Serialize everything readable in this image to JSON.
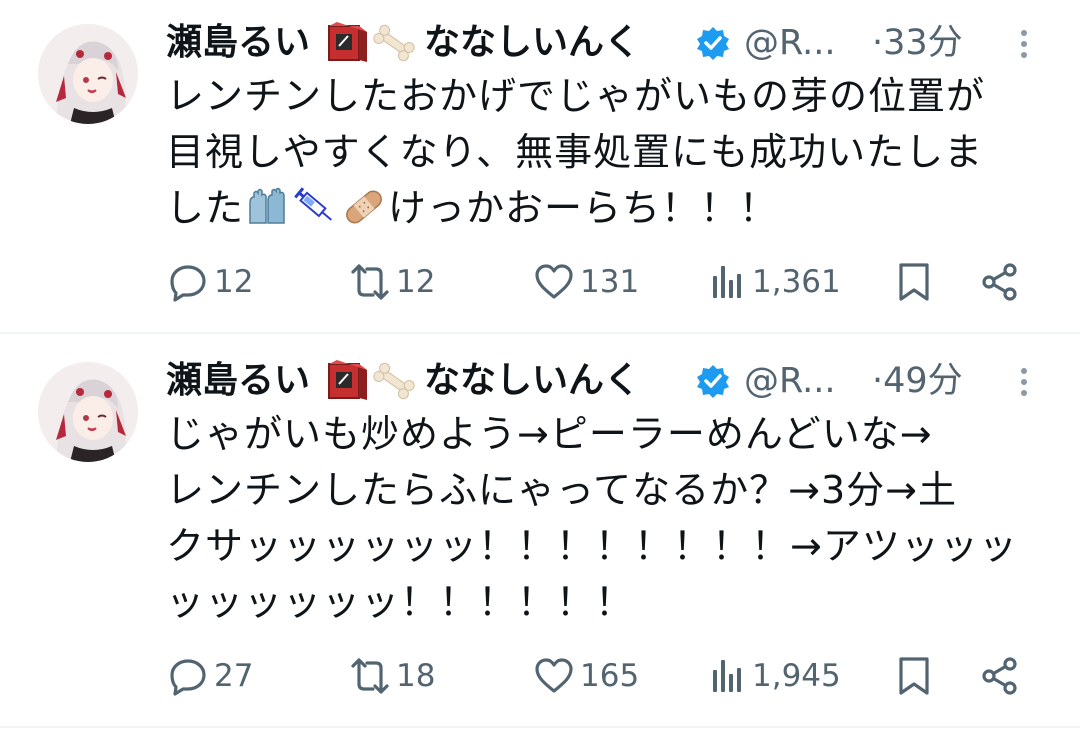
{
  "tweets": [
    {
      "author": {
        "name_part1": "瀬島るい",
        "name_part2": "ななしいんく",
        "handle": "@R...",
        "verified": true
      },
      "time": "·33分",
      "lines": [
        "レンチンしたおかげでじゃがいもの芽の位置が",
        "目視しやすくなり、無事処置にも成功いたしま",
        "した",
        "けっかおーらち！！！"
      ],
      "emojis": [
        "gloves-emoji",
        "syringe-emoji",
        "bandage-emoji"
      ],
      "stats": {
        "replies": "12",
        "retweets": "12",
        "likes": "131",
        "views": "1,361"
      }
    },
    {
      "author": {
        "name_part1": "瀬島るい",
        "name_part2": "ななしいんく",
        "handle": "@R...",
        "verified": true
      },
      "time": "·49分",
      "lines": [
        "じゃがいも炒めよう→ピーラーめんどいな→",
        "レンチンしたらふにゃってなるか？→3分→土",
        "クサッッッッッッ！！！！！！！！→アツッッッ",
        "ッッッッッッ！！！！！！"
      ],
      "stats": {
        "replies": "27",
        "retweets": "18",
        "likes": "165",
        "views": "1,945"
      }
    }
  ],
  "colors": {
    "text": "#0f1419",
    "secondary": "#536471",
    "verified": "#1d9bf0",
    "divider": "#eff3f4"
  }
}
